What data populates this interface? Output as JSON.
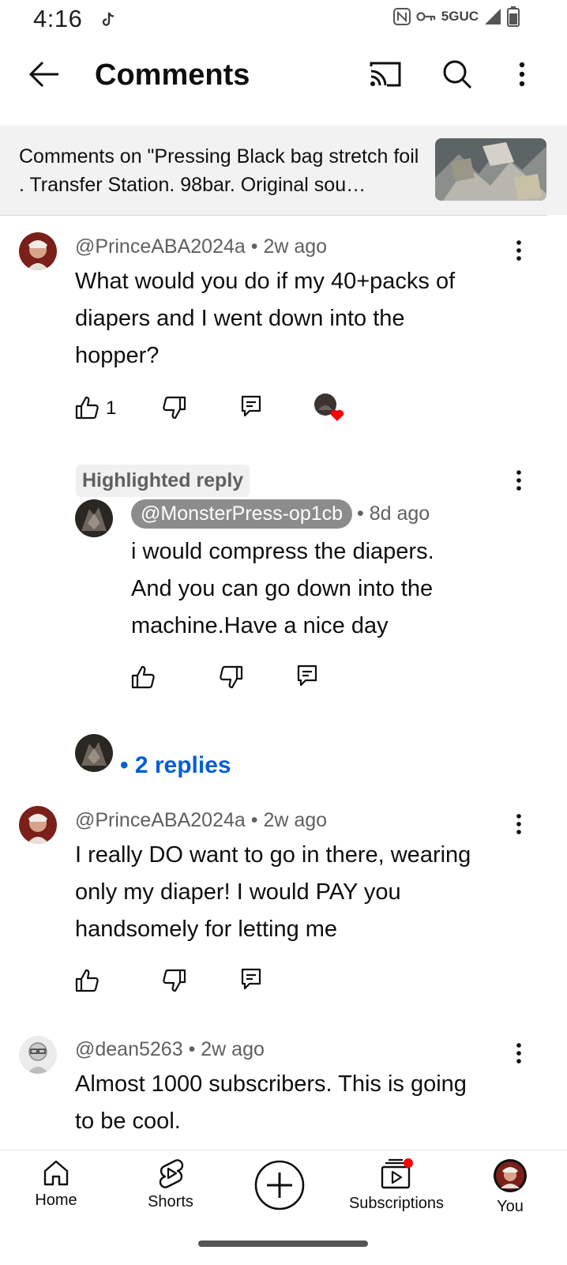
{
  "status": {
    "time": "4:16",
    "network": "5GUC"
  },
  "header": {
    "title": "Comments"
  },
  "banner": {
    "text": "Comments on \"Pressing Black bag stretch foil . Transfer Station. 98bar. Original sou…"
  },
  "comments": [
    {
      "author": "@PrinceABA2024a",
      "age": "• 2w ago",
      "text_lines": [
        "What would you do if my 40+packs of",
        "diapers and I went down into the",
        "hopper?"
      ],
      "likes": "1"
    },
    {
      "author": "@PrinceABA2024a",
      "age": "• 2w ago",
      "text_lines": [
        "I really DO want to go in there, wearing",
        "only my diaper! I would PAY you",
        "handsomely for letting me"
      ]
    },
    {
      "author": "@dean5263",
      "age": "• 2w ago",
      "text_lines": [
        "Almost 1000 subscribers. This is going",
        "to be cool."
      ]
    }
  ],
  "reply": {
    "chip": "Highlighted reply",
    "author": "@MonsterPress-op1cb",
    "age": "• 8d ago",
    "text_lines": [
      "i would compress the diapers.",
      "And you can go down into the",
      "machine.Have a nice day"
    ]
  },
  "replies_link": "• 2 replies",
  "nav": {
    "home": "Home",
    "shorts": "Shorts",
    "subscriptions": "Subscriptions",
    "you": "You"
  },
  "colors": {
    "link": "#065fd4",
    "heart": "#ff0000",
    "notification_dot": "#ff0000"
  }
}
